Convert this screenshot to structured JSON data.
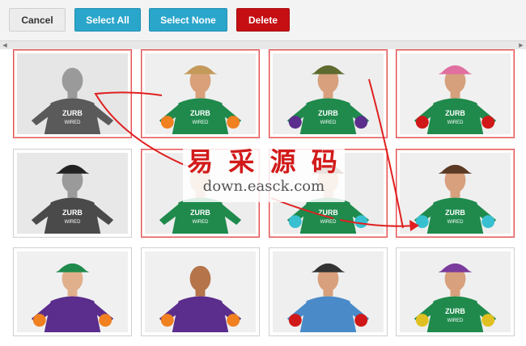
{
  "toolbar": {
    "cancel_label": "Cancel",
    "select_all_label": "Select All",
    "select_none_label": "Select None",
    "delete_label": "Delete"
  },
  "colors": {
    "primary": "#2ba6cb",
    "alert": "#c60f13",
    "selected_border": "#e35050",
    "shirt_green": "#1f8a4c"
  },
  "photos": [
    {
      "row": 1,
      "col": 1,
      "selected": true,
      "tone": "grayscale",
      "subject": "man-shouting"
    },
    {
      "row": 1,
      "col": 2,
      "selected": true,
      "tone": "color",
      "subject": "cowboy-with-leis"
    },
    {
      "row": 1,
      "col": 3,
      "selected": true,
      "tone": "color",
      "subject": "jumping-purple-jacket"
    },
    {
      "row": 1,
      "col": 4,
      "selected": true,
      "tone": "color",
      "subject": "boxing-gloves-woman"
    },
    {
      "row": 2,
      "col": 1,
      "selected": false,
      "tone": "grayscale",
      "subject": "top-hats-pair"
    },
    {
      "row": 2,
      "col": 2,
      "selected": true,
      "tone": "color",
      "subject": "green-shirt-standing"
    },
    {
      "row": 2,
      "col": 3,
      "selected": true,
      "tone": "color",
      "subject": "big-glasses-woman"
    },
    {
      "row": 2,
      "col": 4,
      "selected": true,
      "tone": "color",
      "subject": "big-glasses-man"
    },
    {
      "row": 3,
      "col": 1,
      "selected": false,
      "tone": "color",
      "subject": "mad-hatter"
    },
    {
      "row": 3,
      "col": 2,
      "selected": false,
      "tone": "color",
      "subject": "horse-mask"
    },
    {
      "row": 3,
      "col": 3,
      "selected": false,
      "tone": "color",
      "subject": "boxing-pair"
    },
    {
      "row": 3,
      "col": 4,
      "selected": false,
      "tone": "color",
      "subject": "jester-hat"
    }
  ],
  "shirt_text": {
    "line1": "ZURB",
    "line2": "WIRED"
  },
  "watermark": {
    "cn": "易 采 源 码",
    "url": "down.easck.com"
  },
  "icons": {
    "scroll_left": "arrow-left-icon",
    "scroll_right": "arrow-right-icon"
  }
}
